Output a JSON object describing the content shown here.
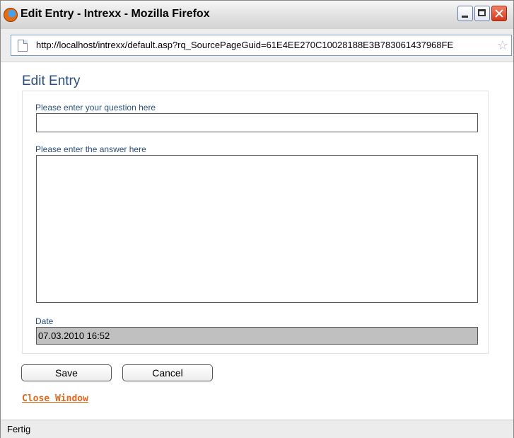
{
  "window": {
    "title": "Edit Entry - Intrexx - Mozilla Firefox"
  },
  "urlbar": {
    "url": "http://localhost/intrexx/default.asp?rq_SourcePageGuid=61E4EE270C10028188E3B783061437968FE"
  },
  "page": {
    "heading": "Edit Entry",
    "question_label": "Please enter your question here",
    "question_value": "",
    "answer_label": "Please enter the answer here",
    "answer_value": "",
    "date_label": "Date",
    "date_value": "07.03.2010 16:52",
    "save_label": "Save",
    "cancel_label": "Cancel",
    "close_link": "Close Window"
  },
  "status": {
    "text": "Fertig"
  },
  "colors": {
    "heading": "#2b4f7c",
    "link": "#e0681e",
    "date_bg": "#c0c0c0"
  },
  "icons": {
    "app": "firefox-icon",
    "page": "page-icon",
    "bookmark": "star-icon"
  }
}
